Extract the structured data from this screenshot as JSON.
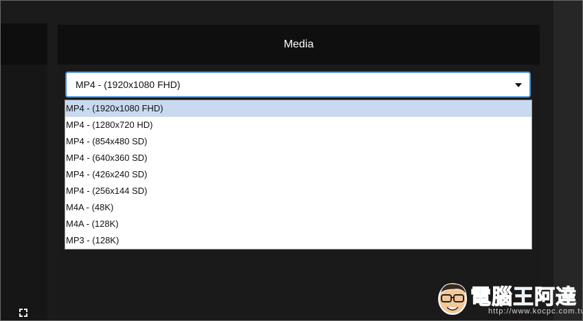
{
  "media_panel": {
    "title": "Media"
  },
  "format_select": {
    "selected_value": "MP4 - (1920x1080 FHD)",
    "options": [
      "MP4 - (1920x1080 FHD)",
      "MP4 - (1280x720 HD)",
      "MP4 - (854x480 SD)",
      "MP4 - (640x360 SD)",
      "MP4 - (426x240 SD)",
      "MP4 - (256x144 SD)",
      "M4A - (48K)",
      "M4A - (128K)",
      "MP3 - (128K)"
    ],
    "highlighted_index": 0
  },
  "controls": {
    "fullscreen_icon": "fullscreen-icon"
  },
  "watermark": {
    "title": "電腦王阿達",
    "url": "http://www.kocpc.com.tw"
  },
  "colors": {
    "background": "#1b1b1b",
    "header": "#0f0f0f",
    "select_border": "#4a90d9",
    "highlight": "#c8daf0",
    "watermark_blue": "#5aa9e6"
  }
}
